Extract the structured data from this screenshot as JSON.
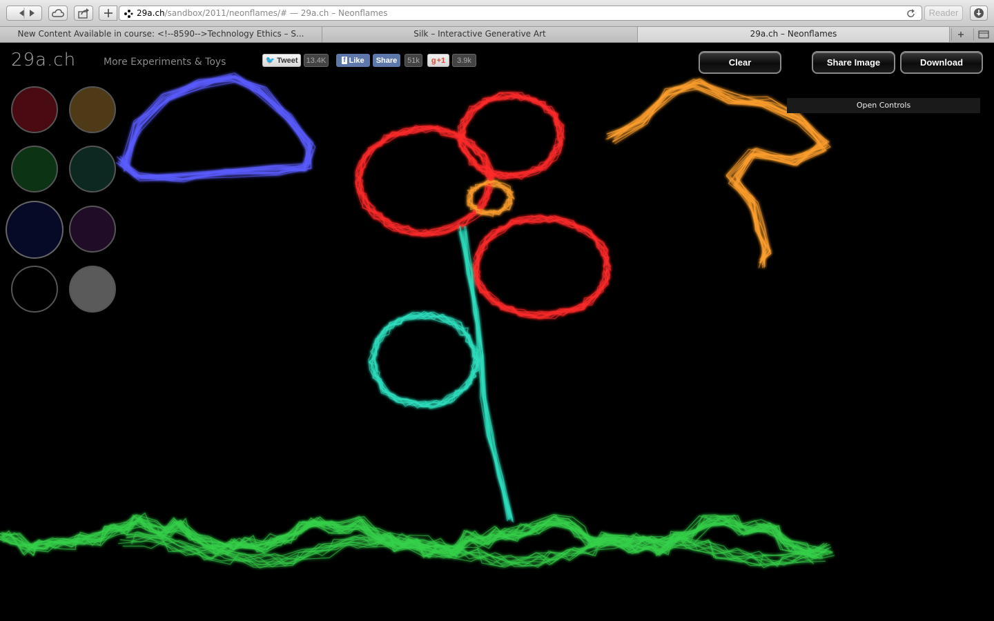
{
  "browser": {
    "url_host": "29a.ch",
    "url_path": "/sandbox/2011/neonflames/#",
    "page_title_suffix": " — 29a.ch – Neonflames",
    "reader_label": "Reader",
    "tabs": [
      {
        "label": "New Content Available in course: <!--8590-->Technology Ethics – S..."
      },
      {
        "label": "Silk – Interactive Generative Art"
      },
      {
        "label": "29a.ch – Neonflames"
      }
    ]
  },
  "site": {
    "logo": "29a.ch",
    "more_link": "More Experiments & Toys"
  },
  "social": {
    "tweet_label": "Tweet",
    "tweet_count": "13.4K",
    "fb_like_label": "Like",
    "fb_share_label": "Share",
    "fb_count": "51k",
    "gplus_label": "+1",
    "gplus_count": "3.9k"
  },
  "controls": {
    "clear": "Clear",
    "share_image": "Share Image",
    "download": "Download",
    "open_controls": "Open Controls"
  },
  "palette": [
    {
      "name": "dark-red",
      "color": "#4a0a12"
    },
    {
      "name": "brown",
      "color": "#4f3a18"
    },
    {
      "name": "dark-green",
      "color": "#0c3414"
    },
    {
      "name": "dark-teal",
      "color": "#0c2820"
    },
    {
      "name": "navy",
      "color": "#060a26",
      "selected": true
    },
    {
      "name": "dark-purple",
      "color": "#200c26"
    },
    {
      "name": "black",
      "color": "#000000"
    },
    {
      "name": "gray",
      "color": "#5a5a5a"
    }
  ],
  "strokes": [
    {
      "name": "blue-cloud",
      "color": "#5b5cff"
    },
    {
      "name": "red-petals",
      "color": "#ff2b2b"
    },
    {
      "name": "orange-tree",
      "color": "#ffa030"
    },
    {
      "name": "teal-leaf-stem",
      "color": "#2fe0c0"
    },
    {
      "name": "green-grass",
      "color": "#37d24a"
    }
  ]
}
